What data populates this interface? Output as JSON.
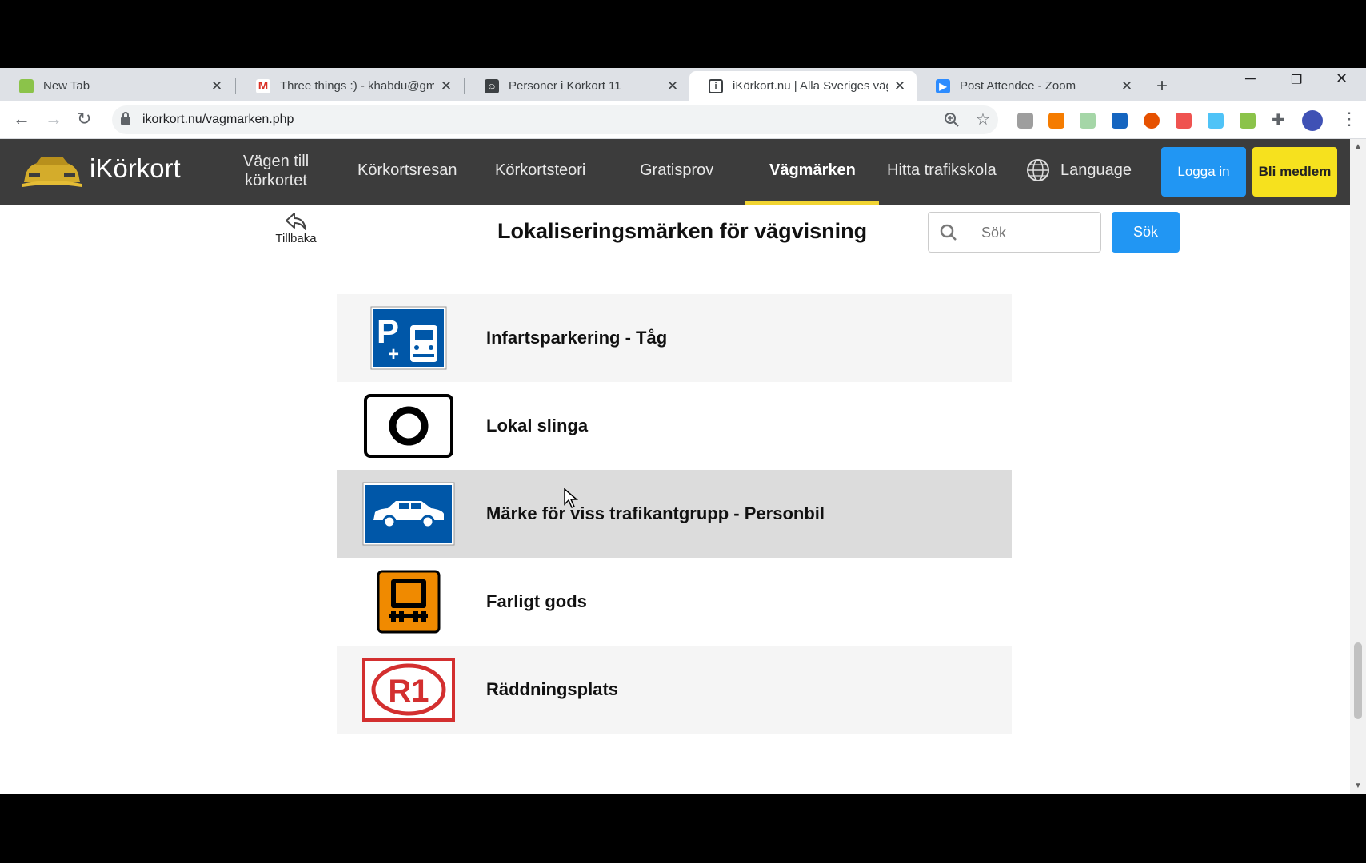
{
  "browser": {
    "tabs": [
      {
        "title": "New Tab",
        "favicon": "new-tab-favicon",
        "active": false
      },
      {
        "title": "Three things :) - khabdu@gma",
        "favicon": "gmail-favicon",
        "active": false
      },
      {
        "title": "Personer i Körkort 11",
        "favicon": "contacts-favicon",
        "active": false
      },
      {
        "title": "iKörkort.nu | Alla Sveriges vägm",
        "favicon": "ikorkort-favicon",
        "active": true
      },
      {
        "title": "Post Attendee - Zoom",
        "favicon": "zoom-favicon",
        "active": false
      }
    ],
    "url": "ikorkort.nu/vagmarken.php"
  },
  "header": {
    "logo_text": "iKörkort",
    "nav": [
      {
        "label": "Vägen till körkortet",
        "active": false
      },
      {
        "label": "Körkortsresan",
        "active": false
      },
      {
        "label": "Körkortsteori",
        "active": false
      },
      {
        "label": "Gratisprov",
        "active": false
      },
      {
        "label": "Vägmärken",
        "active": true
      },
      {
        "label": "Hitta trafikskola",
        "active": false
      }
    ],
    "language_label": "Language",
    "login_label": "Logga in",
    "member_label": "Bli medlem",
    "accent_color": "#f1d432"
  },
  "main": {
    "back_label": "Tillbaka",
    "title": "Lokaliseringsmärken för vägvisning",
    "search_placeholder": "Sök",
    "search_button": "Sök",
    "signs": [
      {
        "name": "",
        "icon": "park-and-ride-bus-sign",
        "partial": true
      },
      {
        "name": "Infartsparkering - Tåg",
        "icon": "park-and-ride-train-sign"
      },
      {
        "name": "Lokal slinga",
        "icon": "local-loop-sign"
      },
      {
        "name": "Märke för viss trafikantgrupp - Personbil",
        "icon": "passenger-car-sign",
        "hover": true
      },
      {
        "name": "Farligt gods",
        "icon": "dangerous-goods-sign"
      },
      {
        "name": "Räddningsplats",
        "icon": "rescue-point-sign",
        "sign_text": "R1"
      }
    ]
  }
}
